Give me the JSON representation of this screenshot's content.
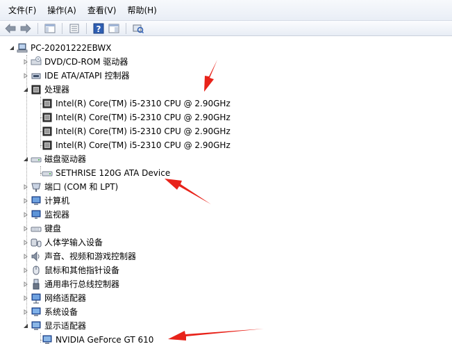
{
  "menu": {
    "items": [
      "文件(F)",
      "操作(A)",
      "查看(V)",
      "帮助(H)"
    ]
  },
  "toolbar": {
    "icons": [
      "back-arrow-icon",
      "forward-arrow-icon",
      "console-tree-icon",
      "properties-icon",
      "help-icon",
      "show-hide-icon",
      "scan-hardware-icon"
    ]
  },
  "tree": {
    "root": "PC-20201222EBWX",
    "nodes": [
      {
        "label": "DVD/CD-ROM 驱动器",
        "expanded": false
      },
      {
        "label": "IDE ATA/ATAPI 控制器",
        "expanded": false
      },
      {
        "label": "处理器",
        "expanded": true
      },
      {
        "label": "Intel(R) Core(TM) i5-2310 CPU @ 2.90GHz",
        "child": true
      },
      {
        "label": "Intel(R) Core(TM) i5-2310 CPU @ 2.90GHz",
        "child": true
      },
      {
        "label": "Intel(R) Core(TM) i5-2310 CPU @ 2.90GHz",
        "child": true
      },
      {
        "label": "Intel(R) Core(TM) i5-2310 CPU @ 2.90GHz",
        "child": true
      },
      {
        "label": "磁盘驱动器",
        "expanded": true
      },
      {
        "label": "SETHRISE 120G ATA Device",
        "child": true
      },
      {
        "label": "端口 (COM 和 LPT)",
        "expanded": false
      },
      {
        "label": "计算机",
        "expanded": false
      },
      {
        "label": "监视器",
        "expanded": false
      },
      {
        "label": "键盘",
        "expanded": false
      },
      {
        "label": "人体学输入设备",
        "expanded": false
      },
      {
        "label": "声音、视频和游戏控制器",
        "expanded": false
      },
      {
        "label": "鼠标和其他指针设备",
        "expanded": false
      },
      {
        "label": "通用串行总线控制器",
        "expanded": false
      },
      {
        "label": "网络适配器",
        "expanded": false
      },
      {
        "label": "系统设备",
        "expanded": false
      },
      {
        "label": "显示适配器",
        "expanded": true
      },
      {
        "label": "NVIDIA GeForce GT 610",
        "child": true
      }
    ]
  },
  "colors": {
    "arrow": "#e8231a"
  }
}
